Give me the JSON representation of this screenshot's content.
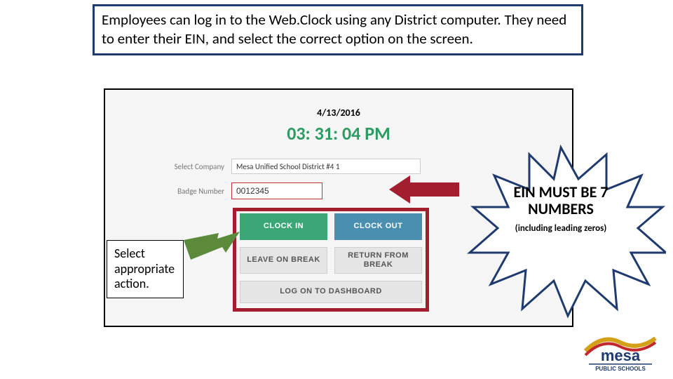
{
  "instruction": "Employees can log in to the Web.Clock using any District computer.  They need to enter their EIN, and select the correct option on the screen.",
  "clock": {
    "date": "4/13/2016",
    "time": "03: 31: 04 PM"
  },
  "form": {
    "company_label": "Select Company",
    "company_value": "Mesa Unified School District #4  1",
    "badge_label": "Badge Number",
    "badge_value": "0012345"
  },
  "buttons": {
    "clock_in": "CLOCK IN",
    "clock_out": "CLOCK OUT",
    "leave_break": "LEAVE ON BREAK",
    "return_break": "RETURN FROM BREAK",
    "dashboard": "LOG ON TO DASHBOARD"
  },
  "callout_action": "Select appropriate action.",
  "starburst": {
    "main": "EIN MUST BE 7 NUMBERS",
    "sub": "(including leading zeros)"
  },
  "logo": {
    "line1": "mesa",
    "line2": "PUBLIC SCHOOLS"
  }
}
